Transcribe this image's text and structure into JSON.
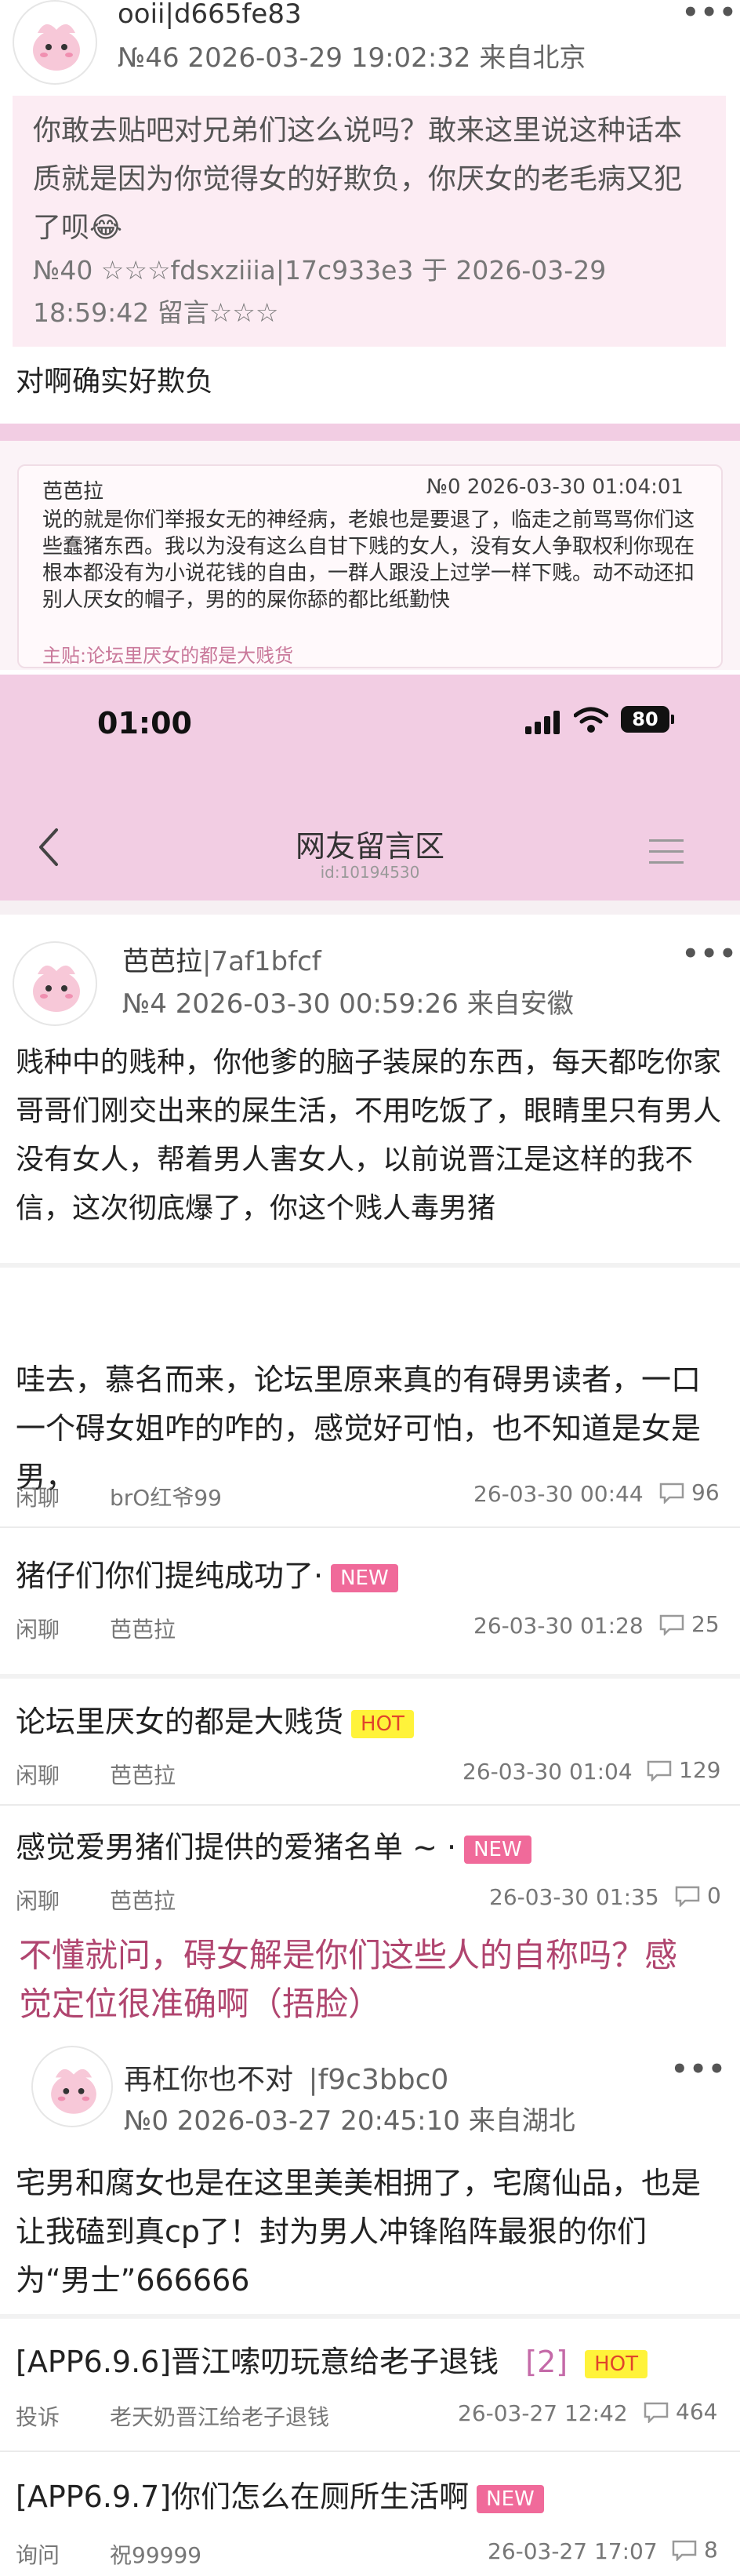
{
  "post1": {
    "user": "ooii|d665fe83",
    "meta": "№46  2026-03-29 19:02:32 来自北京",
    "quote": {
      "text": "你敢去贴吧对兄弟们这么说吗？敢来这里说这种话本质就是因为你觉得女的好欺负，你厌女的老毛病又犯了呗😂",
      "meta1": "№40 ☆☆☆fdsxziiia|17c933e3 于 2026-03-29",
      "meta2": "18:59:42 留言☆☆☆"
    },
    "reply": "对啊确实好欺负"
  },
  "quote_card": {
    "user": "芭芭拉",
    "meta": "№0  2026-03-30 01:04:01",
    "text": "说的就是你们举报女无的神经病，老娘也是要退了，临走之前骂骂你们这些蠢猪东西。我以为没有这么自甘下贱的女人，没有女人争取权利你现在根本都没有为小说花钱的自由，一群人跟没上过学一样下贱。动不动还扣别人厌女的帽子，男的的屎你舔的都比纸勤快",
    "source": "主贴:论坛里厌女的都是大贱货"
  },
  "status_bar": {
    "time": "01:00",
    "battery": "80"
  },
  "nav": {
    "title": "网友留言区",
    "subtitle": "id:10194530"
  },
  "post2": {
    "user": "芭芭拉",
    "user_id": "|7af1bfcf",
    "meta": "№4  2026-03-30 00:59:26 来自安徽",
    "text": "贱种中的贱种，你他爹的脑子装屎的东西，每天都吃你家哥哥们刚交出来的屎生活，不用吃饭了，眼睛里只有男人没有女人，帮着男人害女人，以前说晋江是这样的我不信，这次彻底爆了，你这个贱人毒男猪"
  },
  "threads_a": [
    {
      "title": "哇去，慕名而来，论坛里原来真的有碍男读者，一口一个碍女姐咋的咋的，感觉好可怕，也不知道是女是男，",
      "category": "闲聊",
      "author": "brO红爷99",
      "time": "26-03-30 00:44",
      "comments": "96",
      "badge": ""
    },
    {
      "title": "猪仔们你们提纯成功了·",
      "category": "闲聊",
      "author": "芭芭拉",
      "time": "26-03-30 01:28",
      "comments": "25",
      "badge": "NEW"
    },
    {
      "title": "论坛里厌女的都是大贱货",
      "category": "闲聊",
      "author": "芭芭拉",
      "time": "26-03-30 01:04",
      "comments": "129",
      "badge": "HOT"
    },
    {
      "title": "感觉爱男猪们提供的爱猪名单 ~ ·",
      "category": "闲聊",
      "author": "芭芭拉",
      "time": "26-03-30 01:35",
      "comments": "0",
      "badge": "NEW"
    }
  ],
  "headline": "不懂就问，碍女解是你们这些人的自称吗？感觉定位很准确啊（捂脸）",
  "post3": {
    "user": "再杠你也不对",
    "user_id": "|f9c3bbc0",
    "meta": "№0  2026-03-27 20:45:10 来自湖北",
    "text": "宅男和腐女也是在这里美美相拥了，宅腐仙品，也是让我磕到真cp了！封为男人冲锋陷阵最狠的你们为“男士”666666"
  },
  "threads_b": [
    {
      "title": "[APP6.9.6]晋江嗦叨玩意给老子退钱",
      "extra": "[2]",
      "category": "投诉",
      "author": "老天奶晋江给老子退钱",
      "time": "26-03-27 12:42",
      "comments": "464",
      "badge": "HOT"
    },
    {
      "title": "[APP6.9.7]你们怎么在厕所生活啊",
      "extra": "",
      "category": "询问",
      "author": "祝99999",
      "time": "26-03-27 17:07",
      "comments": "8",
      "badge": "NEW"
    }
  ],
  "colors": {
    "pink_bg": "#fcecf3",
    "pink_header": "#f2cde3",
    "headline": "#b0456f",
    "new_badge": "#f06a9a",
    "hot_badge": "#fff33a"
  }
}
